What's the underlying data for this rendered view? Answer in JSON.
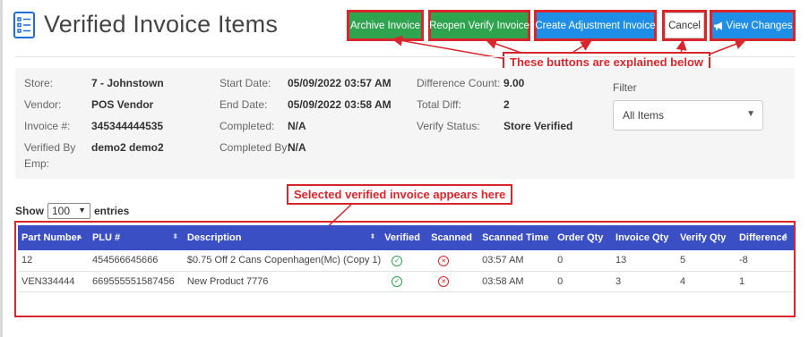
{
  "page": {
    "title": "Verified Invoice Items",
    "icon": "list-icon"
  },
  "toolbar": {
    "archive_label": "Archive Invoice",
    "reopen_label": "Reopen Verify Invoice",
    "adjust_label": "Create Adjustment Invoice",
    "cancel_label": "Cancel",
    "view_label": "View Changes",
    "view_icon": "megaphone-icon"
  },
  "callouts": {
    "buttons": "These buttons are explained below",
    "table": "Selected verified invoice appears here"
  },
  "info": {
    "store_label": "Store:",
    "store_value": "7 - Johnstown",
    "vendor_label": "Vendor:",
    "vendor_value": "POS Vendor",
    "invoice_label": "Invoice #:",
    "invoice_value": "345344444535",
    "verified_by_label_1": "Verified By",
    "verified_by_label_2": "Emp:",
    "verified_by_value": "demo2 demo2",
    "start_label": "Start Date:",
    "start_value": "05/09/2022 03:57 AM",
    "end_label": "End Date:",
    "end_value": "05/09/2022 03:58 AM",
    "completed_label": "Completed:",
    "completed_value": "N/A",
    "completed_by_label": "Completed By:",
    "completed_by_value": "N/A",
    "diff_count_label": "Difference Count:",
    "diff_count_value": "9.00",
    "total_diff_label": "Total Diff:",
    "total_diff_value": "2",
    "verify_status_label": "Verify Status:",
    "verify_status_value": "Store Verified"
  },
  "filter": {
    "label": "Filter",
    "selected": "All Items"
  },
  "entries": {
    "show": "Show",
    "value": "100",
    "suffix": "entries"
  },
  "table": {
    "columns": [
      "Part Number",
      "PLU #",
      "Description",
      "Verified",
      "Scanned",
      "Scanned Time",
      "Order Qty",
      "Invoice Qty",
      "Verify Qty",
      "Difference"
    ],
    "rows": [
      [
        "12",
        "454566645666",
        "$0.75 Off 2 Cans Copenhagen(Mc) (Copy 1)",
        "check",
        "cross",
        "03:57 AM",
        "0",
        "13",
        "5",
        "-8"
      ],
      [
        "VEN334444",
        "669555551587456",
        "New Product 7776",
        "check",
        "cross",
        "03:58 AM",
        "0",
        "3",
        "4",
        "1"
      ]
    ]
  },
  "colors": {
    "accent_green": "#2ea44f",
    "accent_blue": "#1e8ee6",
    "header_blue": "#3a4fc4",
    "annotation_red": "#d9262c"
  }
}
